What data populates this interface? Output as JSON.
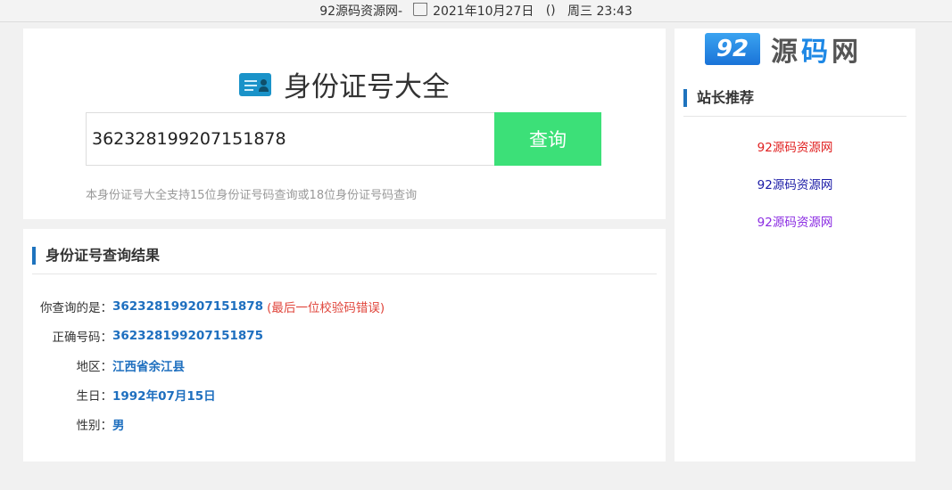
{
  "topbar": {
    "site": "92源码资源网-",
    "date": "2021年10月27日",
    "paren": "()",
    "weekday_time": "周三 23:43"
  },
  "search": {
    "title": "身份证号大全",
    "input_value": "362328199207151878",
    "button_label": "查询",
    "hint": "本身份证号大全支持15位身份证号码查询或18位身份证号码查询"
  },
  "result": {
    "heading": "身份证号查询结果",
    "query_label": "你查询的是：",
    "query_value": "362328199207151878",
    "query_note": "(最后一位校验码错误)",
    "correct_label": "正确号码：",
    "correct_value": "362328199207151875",
    "region_label": "地区：",
    "region_value": "江西省余江县",
    "birth_label": "生日：",
    "birth_value": "1992年07月15日",
    "gender_label": "性别：",
    "gender_value": "男"
  },
  "sidebar": {
    "logo_badge": "92",
    "logo_text_a": "源",
    "logo_text_b": "码",
    "logo_text_c": "网",
    "heading": "站长推荐",
    "links": [
      {
        "label": "92源码资源网",
        "color": "#e02020"
      },
      {
        "label": "92源码资源网",
        "color": "#1a1aa6"
      },
      {
        "label": "92源码资源网",
        "color": "#8a2be2"
      }
    ]
  }
}
